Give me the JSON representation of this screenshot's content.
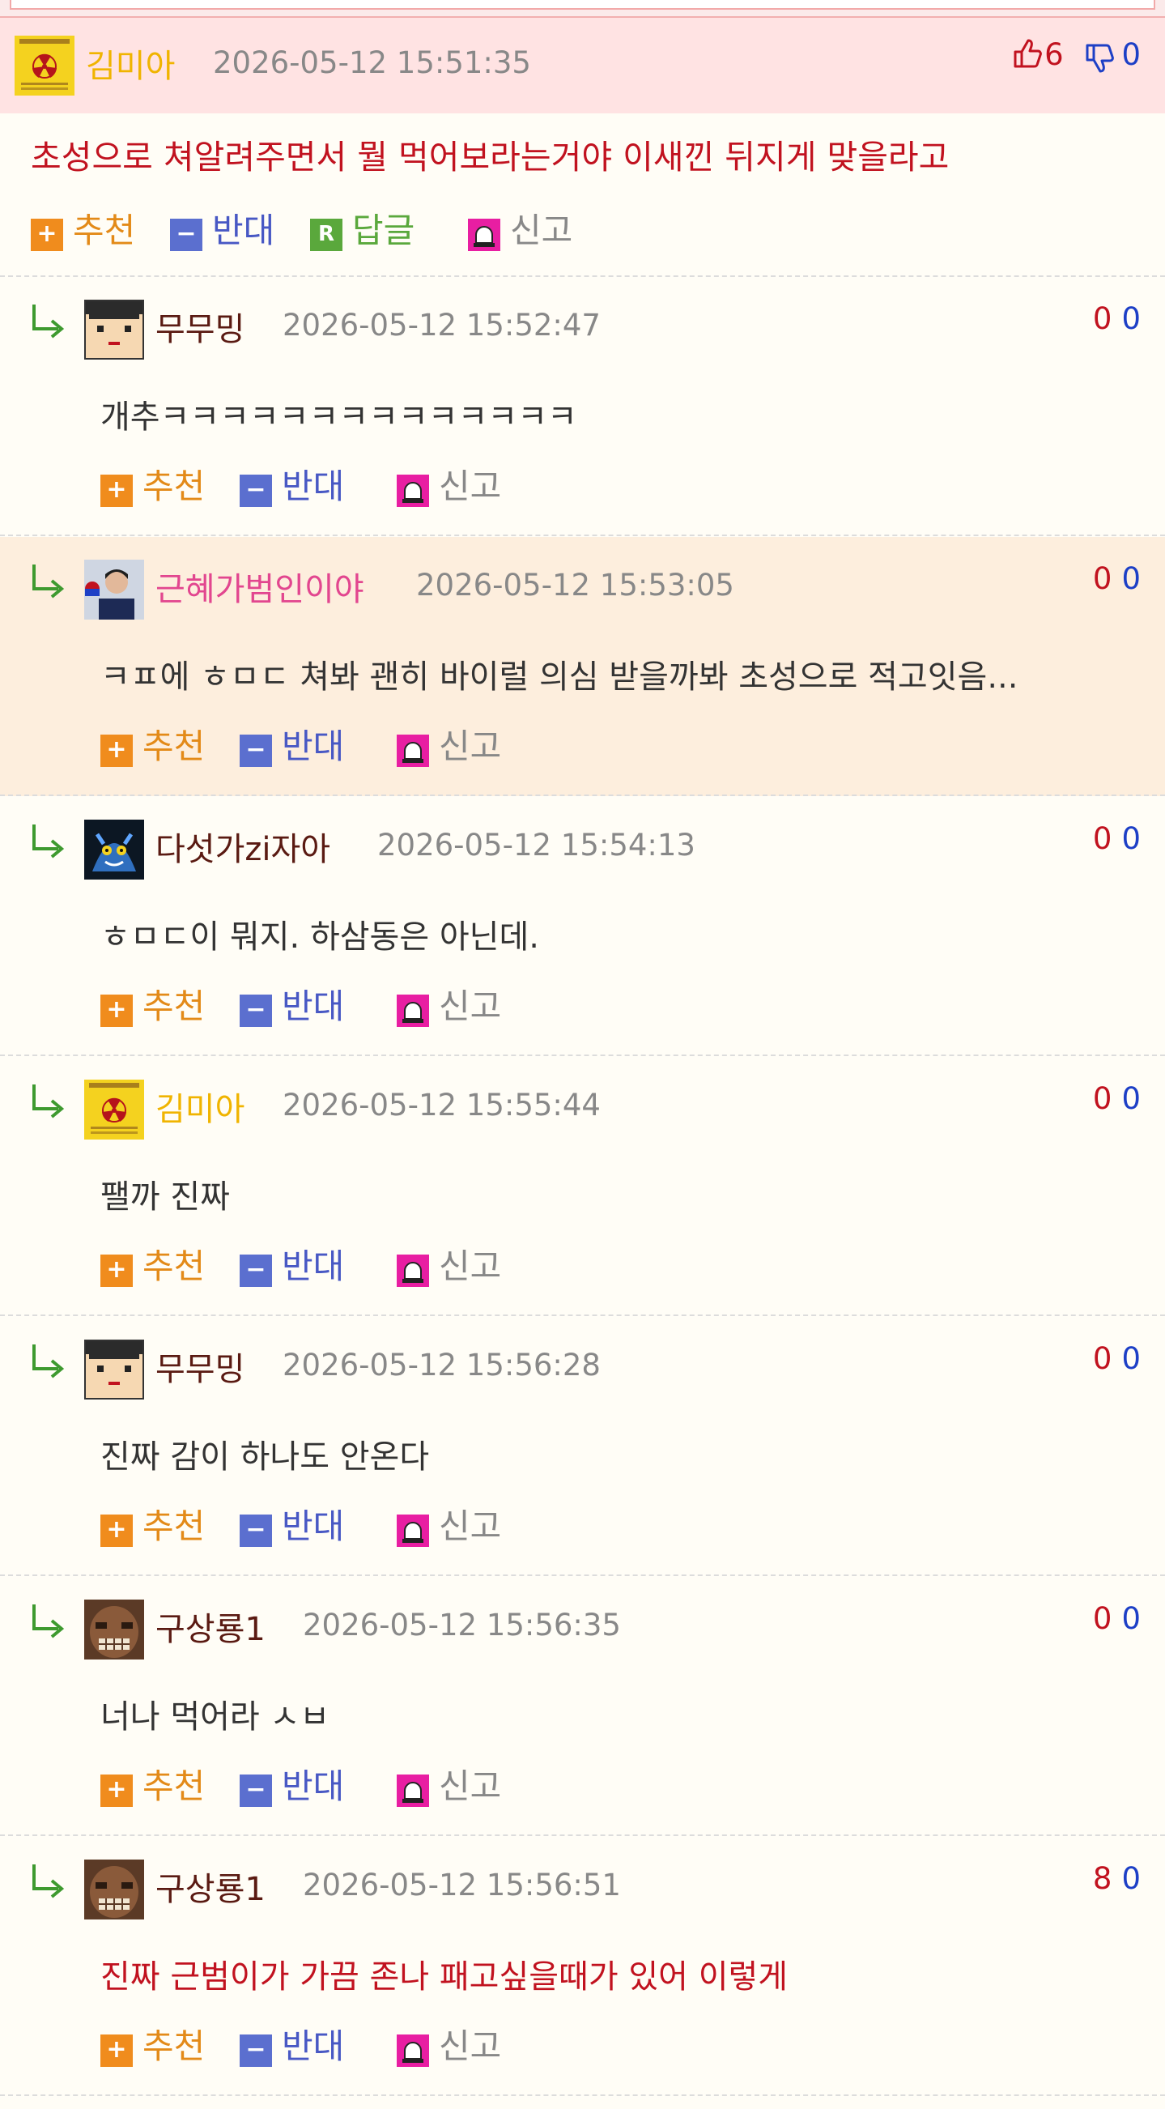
{
  "colors": {
    "header_bg": "#ffe3e3",
    "highlight_row_bg": "#fdeedd",
    "accent_red": "#c1121f",
    "accent_blue": "#1d3fc6",
    "recommend_orange": "#e38a18",
    "oppose_blue": "#4858c4",
    "reply_green": "#5aa83c",
    "report_magenta": "#e81ea2"
  },
  "actions": {
    "recommend": "추천",
    "oppose": "반대",
    "reply": "답글",
    "report": "신고"
  },
  "main_comment": {
    "nickname": "김미아",
    "date": "2026-05-12 15:51:35",
    "up": "6",
    "down": "0",
    "text": "초성으로 쳐알려주면서 뭘 먹어보라는거야 이새낀 뒤지게 맞을라고",
    "avatar": "radiation-badge-avatar"
  },
  "replies": [
    {
      "nickname": "무무밍",
      "date": "2026-05-12 15:52:47",
      "up": "0",
      "down": "0",
      "text": "개추ㅋㅋㅋㅋㅋㅋㅋㅋㅋㅋㅋㅋㅋㅋ",
      "avatar": "pixel-face-avatar"
    },
    {
      "nickname": "근혜가범인이야",
      "date": "2026-05-12 15:53:05",
      "up": "0",
      "down": "0",
      "text": "ㅋㅍ에 ㅎㅁㄷ 쳐봐 괜히 바이럴 의심 받을까봐 초성으로 적고잇음...",
      "avatar": "photo-avatar"
    },
    {
      "nickname": "다섯가zi자아",
      "date": "2026-05-12 15:54:13",
      "up": "0",
      "down": "0",
      "text": "ㅎㅁㄷ이 뭐지. 하삼동은 아닌데.",
      "avatar": "blue-creature-avatar"
    },
    {
      "nickname": "김미아",
      "date": "2026-05-12 15:55:44",
      "up": "0",
      "down": "0",
      "text": "팰까 진짜",
      "avatar": "radiation-badge-avatar"
    },
    {
      "nickname": "무무밍",
      "date": "2026-05-12 15:56:28",
      "up": "0",
      "down": "0",
      "text": "진짜 감이 하나도 안온다",
      "avatar": "pixel-face-avatar"
    },
    {
      "nickname": "구상룡1",
      "date": "2026-05-12 15:56:35",
      "up": "0",
      "down": "0",
      "text": "너나 먹어라 ㅅㅂ",
      "avatar": "monster-face-avatar"
    },
    {
      "nickname": "구상룡1",
      "date": "2026-05-12 15:56:51",
      "up": "8",
      "down": "0",
      "text": "진짜 근범이가 가끔 존나 패고싶을때가 있어 이렇게",
      "avatar": "monster-face-avatar"
    }
  ]
}
